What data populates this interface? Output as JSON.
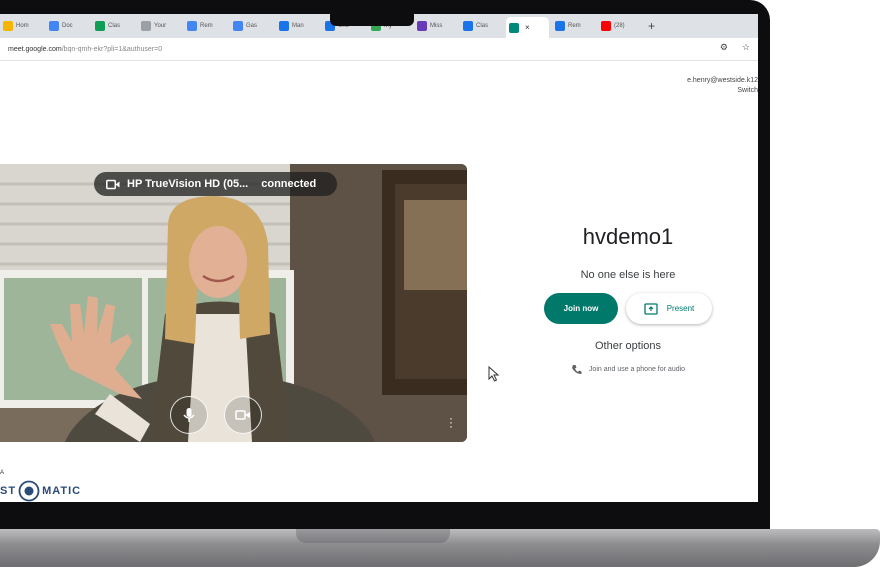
{
  "browser": {
    "tabs": [
      {
        "label": "Hom",
        "color": "#f4b400"
      },
      {
        "label": "Doc",
        "color": "#4285f4"
      },
      {
        "label": "Clas",
        "color": "#0f9d58"
      },
      {
        "label": "Your",
        "color": "#9aa0a6"
      },
      {
        "label": "Rem",
        "color": "#4285f4"
      },
      {
        "label": "Gas",
        "color": "#4285f4"
      },
      {
        "label": "Man",
        "color": "#1a73e8"
      },
      {
        "label": "Unti",
        "color": "#1a73e8"
      },
      {
        "label": "My",
        "color": "#34a853"
      },
      {
        "label": "Miss",
        "color": "#673ab7"
      },
      {
        "label": "Clas",
        "color": "#1a73e8"
      },
      {
        "label": "",
        "color": "#00897b",
        "active": true
      },
      {
        "label": "Rem",
        "color": "#1a73e8"
      },
      {
        "label": "(28)",
        "color": "#ff0000"
      }
    ],
    "new_tab_glyph": "+",
    "close_glyph": "×",
    "url_host": "meet.google.com",
    "url_path": "/bqn-qmh-ekr?pli=1&authuser=0"
  },
  "account": {
    "email": "e.henry@westside.k12",
    "switch_label": "Switch"
  },
  "preview": {
    "camera_name": "HP TrueVision HD (05...",
    "camera_status": "connected"
  },
  "join_panel": {
    "meeting_name": "hvdemo1",
    "presence_text": "No one else is here",
    "join_label": "Join now",
    "present_label": "Present",
    "other_options": "Other options",
    "phone_audio_label": "Join and use a phone for audio"
  },
  "watermark": {
    "top_text": "A",
    "brand": "ST",
    "brand_suffix": "MATIC"
  },
  "colors": {
    "accent": "#00796b",
    "tabstrip": "#dee1e6"
  }
}
